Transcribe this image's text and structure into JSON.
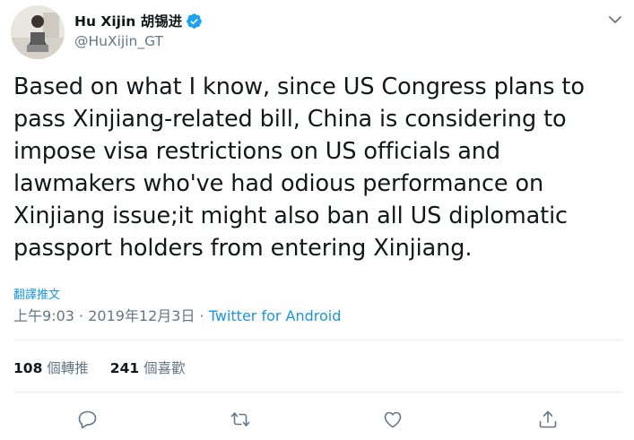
{
  "author": {
    "name": "Hu Xijin 胡锡进",
    "handle": "@HuXijin_GT",
    "verified": true,
    "avatar_icon": "avatar-photo"
  },
  "tweet": {
    "text_lines": [
      "Based on what I know, since US Congress plans to",
      "pass Xinjiang-related bill, China is considering to",
      "impose visa restrictions on US officials and",
      "lawmakers who've had odious performance on",
      "Xinjiang issue;it might also ban all US diplomatic",
      "passport holders from entering Xinjiang."
    ],
    "translate_label": "翻譯推文",
    "time": "上午9:03",
    "separator1": " · ",
    "date": "2019年12月3日",
    "separator2": " · ",
    "source": "Twitter for Android"
  },
  "stats": {
    "retweets_count": "108",
    "retweets_label": " 個轉推",
    "likes_count": "241",
    "likes_label": " 個喜歡"
  },
  "actions": {
    "reply_icon": "reply-icon",
    "retweet_icon": "retweet-icon",
    "like_icon": "like-icon",
    "share_icon": "share-icon"
  },
  "colors": {
    "text": "#14171a",
    "secondary": "#657786",
    "link": "#1b95e0",
    "verified": "#1da1f2",
    "divider": "#e6ecf0"
  }
}
